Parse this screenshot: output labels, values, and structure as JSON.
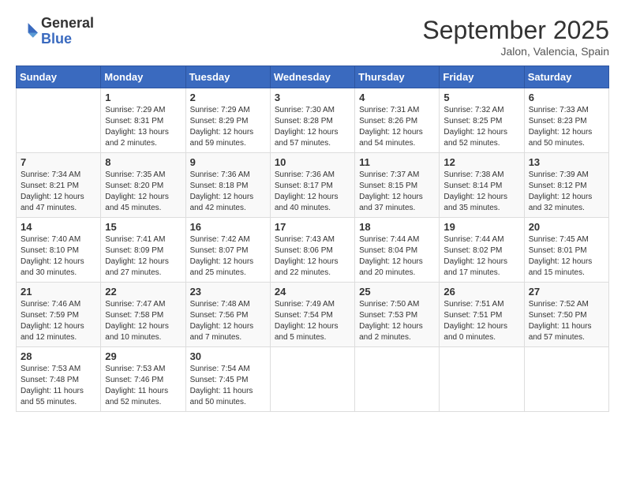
{
  "header": {
    "logo_general": "General",
    "logo_blue": "Blue",
    "title": "September 2025",
    "subtitle": "Jalon, Valencia, Spain"
  },
  "days_of_week": [
    "Sunday",
    "Monday",
    "Tuesday",
    "Wednesday",
    "Thursday",
    "Friday",
    "Saturday"
  ],
  "weeks": [
    [
      {
        "day": "",
        "info": ""
      },
      {
        "day": "1",
        "info": "Sunrise: 7:29 AM\nSunset: 8:31 PM\nDaylight: 13 hours and 2 minutes."
      },
      {
        "day": "2",
        "info": "Sunrise: 7:29 AM\nSunset: 8:29 PM\nDaylight: 12 hours and 59 minutes."
      },
      {
        "day": "3",
        "info": "Sunrise: 7:30 AM\nSunset: 8:28 PM\nDaylight: 12 hours and 57 minutes."
      },
      {
        "day": "4",
        "info": "Sunrise: 7:31 AM\nSunset: 8:26 PM\nDaylight: 12 hours and 54 minutes."
      },
      {
        "day": "5",
        "info": "Sunrise: 7:32 AM\nSunset: 8:25 PM\nDaylight: 12 hours and 52 minutes."
      },
      {
        "day": "6",
        "info": "Sunrise: 7:33 AM\nSunset: 8:23 PM\nDaylight: 12 hours and 50 minutes."
      }
    ],
    [
      {
        "day": "7",
        "info": "Sunrise: 7:34 AM\nSunset: 8:21 PM\nDaylight: 12 hours and 47 minutes."
      },
      {
        "day": "8",
        "info": "Sunrise: 7:35 AM\nSunset: 8:20 PM\nDaylight: 12 hours and 45 minutes."
      },
      {
        "day": "9",
        "info": "Sunrise: 7:36 AM\nSunset: 8:18 PM\nDaylight: 12 hours and 42 minutes."
      },
      {
        "day": "10",
        "info": "Sunrise: 7:36 AM\nSunset: 8:17 PM\nDaylight: 12 hours and 40 minutes."
      },
      {
        "day": "11",
        "info": "Sunrise: 7:37 AM\nSunset: 8:15 PM\nDaylight: 12 hours and 37 minutes."
      },
      {
        "day": "12",
        "info": "Sunrise: 7:38 AM\nSunset: 8:14 PM\nDaylight: 12 hours and 35 minutes."
      },
      {
        "day": "13",
        "info": "Sunrise: 7:39 AM\nSunset: 8:12 PM\nDaylight: 12 hours and 32 minutes."
      }
    ],
    [
      {
        "day": "14",
        "info": "Sunrise: 7:40 AM\nSunset: 8:10 PM\nDaylight: 12 hours and 30 minutes."
      },
      {
        "day": "15",
        "info": "Sunrise: 7:41 AM\nSunset: 8:09 PM\nDaylight: 12 hours and 27 minutes."
      },
      {
        "day": "16",
        "info": "Sunrise: 7:42 AM\nSunset: 8:07 PM\nDaylight: 12 hours and 25 minutes."
      },
      {
        "day": "17",
        "info": "Sunrise: 7:43 AM\nSunset: 8:06 PM\nDaylight: 12 hours and 22 minutes."
      },
      {
        "day": "18",
        "info": "Sunrise: 7:44 AM\nSunset: 8:04 PM\nDaylight: 12 hours and 20 minutes."
      },
      {
        "day": "19",
        "info": "Sunrise: 7:44 AM\nSunset: 8:02 PM\nDaylight: 12 hours and 17 minutes."
      },
      {
        "day": "20",
        "info": "Sunrise: 7:45 AM\nSunset: 8:01 PM\nDaylight: 12 hours and 15 minutes."
      }
    ],
    [
      {
        "day": "21",
        "info": "Sunrise: 7:46 AM\nSunset: 7:59 PM\nDaylight: 12 hours and 12 minutes."
      },
      {
        "day": "22",
        "info": "Sunrise: 7:47 AM\nSunset: 7:58 PM\nDaylight: 12 hours and 10 minutes."
      },
      {
        "day": "23",
        "info": "Sunrise: 7:48 AM\nSunset: 7:56 PM\nDaylight: 12 hours and 7 minutes."
      },
      {
        "day": "24",
        "info": "Sunrise: 7:49 AM\nSunset: 7:54 PM\nDaylight: 12 hours and 5 minutes."
      },
      {
        "day": "25",
        "info": "Sunrise: 7:50 AM\nSunset: 7:53 PM\nDaylight: 12 hours and 2 minutes."
      },
      {
        "day": "26",
        "info": "Sunrise: 7:51 AM\nSunset: 7:51 PM\nDaylight: 12 hours and 0 minutes."
      },
      {
        "day": "27",
        "info": "Sunrise: 7:52 AM\nSunset: 7:50 PM\nDaylight: 11 hours and 57 minutes."
      }
    ],
    [
      {
        "day": "28",
        "info": "Sunrise: 7:53 AM\nSunset: 7:48 PM\nDaylight: 11 hours and 55 minutes."
      },
      {
        "day": "29",
        "info": "Sunrise: 7:53 AM\nSunset: 7:46 PM\nDaylight: 11 hours and 52 minutes."
      },
      {
        "day": "30",
        "info": "Sunrise: 7:54 AM\nSunset: 7:45 PM\nDaylight: 11 hours and 50 minutes."
      },
      {
        "day": "",
        "info": ""
      },
      {
        "day": "",
        "info": ""
      },
      {
        "day": "",
        "info": ""
      },
      {
        "day": "",
        "info": ""
      }
    ]
  ]
}
